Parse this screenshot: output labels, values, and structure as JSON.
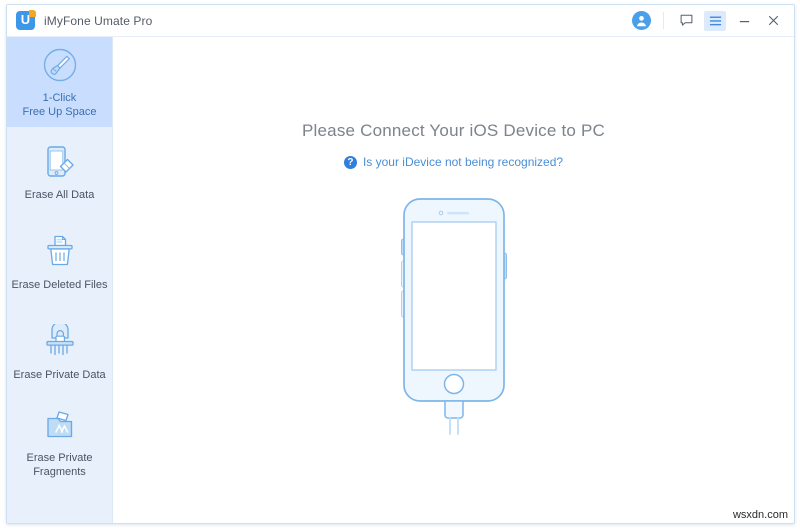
{
  "window": {
    "title": "iMyFone Umate Pro",
    "logo_letter": "U",
    "accent_blue": "#3d97e8",
    "accent_orange": "#f5a623"
  },
  "titlebar": {
    "avatar_icon": "user-avatar-icon",
    "buttons": [
      {
        "name": "feedback-icon",
        "label": ""
      },
      {
        "name": "menu-icon",
        "label": ""
      },
      {
        "name": "minimize-icon",
        "label": ""
      },
      {
        "name": "close-icon",
        "label": ""
      }
    ]
  },
  "sidebar": {
    "items": [
      {
        "label_line1": "1-Click",
        "label_line2": "Free Up Space",
        "icon": "broom-circle-icon",
        "selected": true
      },
      {
        "label_line1": "Erase All Data",
        "label_line2": "",
        "icon": "phone-eraser-icon",
        "selected": false
      },
      {
        "label_line1": "Erase Deleted Files",
        "label_line2": "",
        "icon": "trash-can-icon",
        "selected": false
      },
      {
        "label_line1": "Erase Private Data",
        "label_line2": "",
        "icon": "shredder-lock-icon",
        "selected": false
      },
      {
        "label_line1": "Erase Private",
        "label_line2": "Fragments",
        "icon": "folder-app-icon",
        "selected": false
      }
    ]
  },
  "main": {
    "headline": "Please Connect Your iOS Device to PC",
    "help_link": "Is your iDevice not being recognized?",
    "help_icon_glyph": "?",
    "illustration": "iphone-with-lightning-cable-illustration"
  },
  "watermark": "wsxdn.com"
}
